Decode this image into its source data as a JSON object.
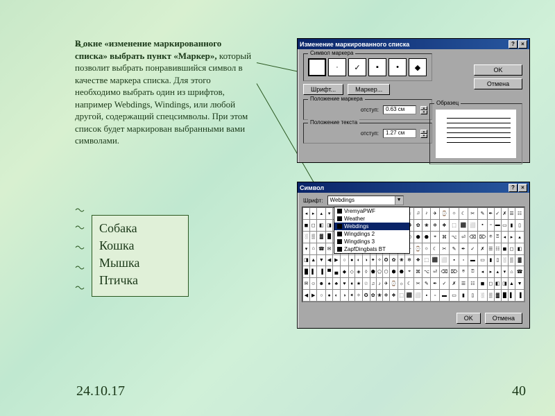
{
  "main_text": {
    "bold_part": "В окне «изменение маркированного списка» выбрать пункт «Маркер»,",
    "rest": " который позволит выбрать понравившийся символ в качестве маркера списка. Для этого необходимо выбрать один из шрифтов, например Webdings, Windings, или любой другой, содержащий спецсимволы. При этом список будет маркирован выбранными вами символами."
  },
  "list": [
    "Собака",
    "Кошка",
    "Мышка",
    "Птичка"
  ],
  "footer": {
    "date": "24.10.17",
    "page": "40"
  },
  "dlg1": {
    "title": "Изменение маркированного списка",
    "sym_marker_legend": "Символ маркера",
    "markers": [
      "",
      "·",
      "✓",
      "▪",
      "•",
      "◆"
    ],
    "font_btn": "Шрифт...",
    "marker_btn": "Маркер...",
    "ok": "OK",
    "cancel": "Отмена",
    "preview_legend": "Образец",
    "pos_marker_legend": "Положение маркера",
    "pos_text_legend": "Положение текста",
    "indent_label": "отступ:",
    "indent1": "0.63 см",
    "indent2": "1.27 см"
  },
  "dlg2": {
    "title": "Символ",
    "font_label": "Шрифт:",
    "selected_font": "Webdings",
    "options": [
      "VremyaPWF",
      "Weather",
      "Webdings",
      "Wingdings 2",
      "Wingdings 3",
      "ZapfDingbats BT"
    ],
    "ok": "OK",
    "cancel": "Отмена"
  }
}
